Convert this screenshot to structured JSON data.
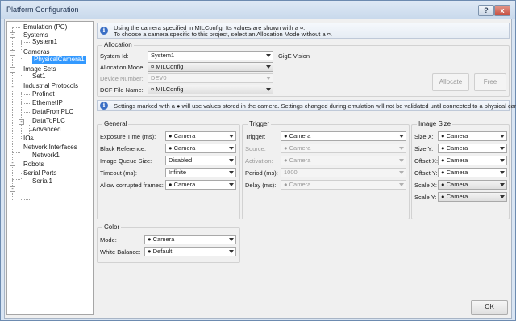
{
  "window": {
    "title": "Platform Configuration",
    "help_glyph": "?",
    "close_glyph": "x"
  },
  "tree": {
    "nodes": [
      {
        "label": "Emulation (PC)"
      },
      {
        "label": "Systems"
      },
      {
        "label": "System1"
      },
      {
        "label": "Cameras"
      },
      {
        "label": "PhysicalCamera1"
      },
      {
        "label": "Image Sets"
      },
      {
        "label": "Set1"
      },
      {
        "label": "Industrial Protocols"
      },
      {
        "label": "Profinet"
      },
      {
        "label": "EthernetIP"
      },
      {
        "label": "DataFromPLC"
      },
      {
        "label": "DataToPLC"
      },
      {
        "label": "Advanced"
      },
      {
        "label": "IOs"
      },
      {
        "label": "Network Interfaces"
      },
      {
        "label": "Network1"
      },
      {
        "label": "Robots"
      },
      {
        "label": "Serial Ports"
      },
      {
        "label": "Serial1"
      }
    ],
    "expander_glyph": "-"
  },
  "info1": {
    "icon": "i",
    "line1": "Using the camera specified in MILConfig.  Its values are shown with a ¤.",
    "line2": "To choose a camera specific to this project, select an Allocation Mode without a ¤."
  },
  "allocation": {
    "title": "Allocation",
    "system_id_label": "System Id:",
    "system_id_value": "System1",
    "camera_type": "GigE Vision",
    "mode_label": "Allocation Mode:",
    "mode_value": "¤ MILConfig",
    "device_label": "Device Number:",
    "device_value": "DEV0",
    "dcf_label": "DCF File Name:",
    "dcf_value": "¤ MILConfig",
    "allocate_button": "Allocate",
    "free_button": "Free"
  },
  "info2": {
    "icon": "i",
    "text": "Settings marked with a ● will use values stored in the camera.  Settings changed during emulation will not be validated until connected to a physical camera."
  },
  "general": {
    "title": "General",
    "rows": [
      {
        "label": "Exposure Time (ms):",
        "value": "● Camera"
      },
      {
        "label": "Black Reference:",
        "value": "● Camera"
      },
      {
        "label": "Image Queue Size:",
        "value": "Disabled"
      },
      {
        "label": "Timeout (ms):",
        "value": "Infinite"
      },
      {
        "label": "Allow corrupted frames:",
        "value": "● Camera"
      }
    ]
  },
  "trigger": {
    "title": "Trigger",
    "rows": [
      {
        "label": "Trigger:",
        "value": "● Camera"
      },
      {
        "label": "Source:",
        "value": "● Camera"
      },
      {
        "label": "Activation:",
        "value": "● Camera"
      },
      {
        "label": "Period (ms):",
        "value": "1000"
      },
      {
        "label": "Delay (ms):",
        "value": "● Camera"
      }
    ]
  },
  "image_size": {
    "title": "Image Size",
    "rows": [
      {
        "label": "Size X:",
        "value": "● Camera"
      },
      {
        "label": "Size Y:",
        "value": "● Camera"
      },
      {
        "label": "Offset X:",
        "value": "● Camera"
      },
      {
        "label": "Offset Y:",
        "value": "● Camera"
      },
      {
        "label": "Scale X:",
        "value": "● Camera"
      },
      {
        "label": "Scale Y:",
        "value": "● Camera"
      }
    ]
  },
  "color": {
    "title": "Color",
    "mode_label": "Mode:",
    "mode_value": "● Camera",
    "wb_label": "White Balance:",
    "wb_value": "● Default"
  },
  "ok_button": "OK"
}
